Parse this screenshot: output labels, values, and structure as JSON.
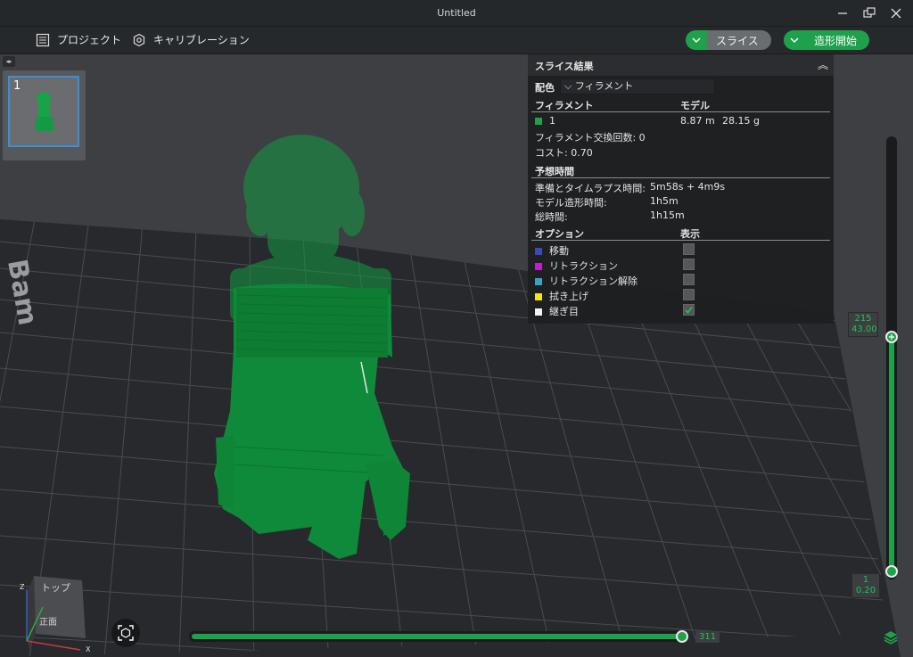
{
  "window": {
    "title": "Untitled"
  },
  "toolbar": {
    "project_label": "プロジェクト",
    "calibration_label": "キャリブレーション",
    "slice_label": "スライス",
    "print_label": "造形開始"
  },
  "plate": {
    "number": "1"
  },
  "slice_panel": {
    "title": "スライス結果",
    "color_label": "配色",
    "color_value": "フィラメント",
    "filament_header": "フィラメント",
    "model_header": "モデル",
    "filament_row": {
      "id": "1",
      "length": "8.87 m",
      "weight": "28.15 g",
      "color": "#1fa14b"
    },
    "change_count": "フィラメント交換回数:  0",
    "cost": "コスト:  0.70",
    "time_header": "予想時間",
    "times": [
      {
        "label": "準備とタイムラプス時間:",
        "value": "5m58s + 4m9s"
      },
      {
        "label": "モデル造形時間:",
        "value": "1h5m"
      },
      {
        "label": "総時間:",
        "value": "1h15m"
      }
    ],
    "option_header": "オプション",
    "display_header": "表示",
    "options": [
      {
        "label": "移動",
        "color": "#3b4bb5",
        "checked": false
      },
      {
        "label": "リトラクション",
        "color": "#c020c8",
        "checked": false
      },
      {
        "label": "リトラクション解除",
        "color": "#35a3c6",
        "checked": false
      },
      {
        "label": "拭き上げ",
        "color": "#f2e51d",
        "checked": false
      },
      {
        "label": "継ぎ目",
        "color": "#f2f2f2",
        "checked": true
      }
    ]
  },
  "layer_slider": {
    "top_layer": "215",
    "top_height": "43.00",
    "bottom_layer": "1",
    "bottom_height": "0.20"
  },
  "move_slider": {
    "value": "311"
  },
  "view_cube": {
    "top_label": "トップ",
    "front_label": "正面",
    "x_axis": "X",
    "z_axis": "Z"
  },
  "bed": {
    "brand_text": "Bam"
  },
  "colors": {
    "accent": "#1fa14b",
    "model": "#0f8a3a"
  }
}
